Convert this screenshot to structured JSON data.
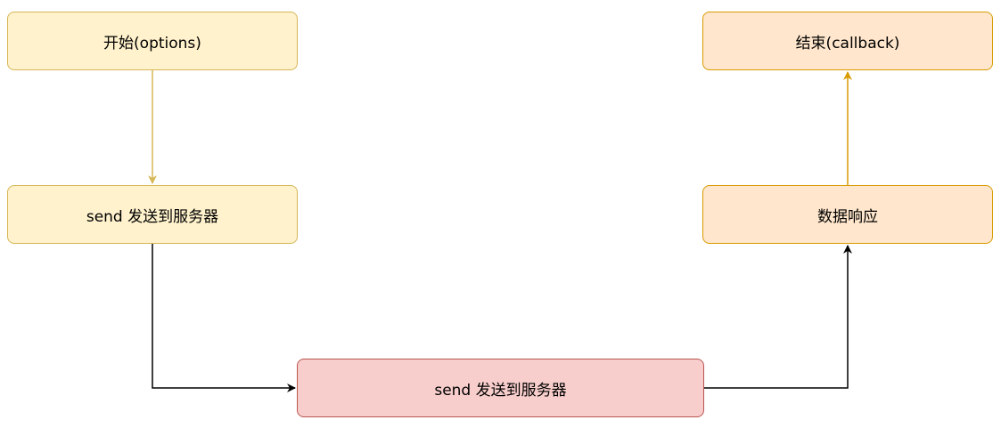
{
  "nodes": {
    "start": {
      "label": "开始(options)"
    },
    "send_client": {
      "label": "send 发送到服务器"
    },
    "send_server": {
      "label": "send 发送到服务器"
    },
    "response": {
      "label": "数据响应"
    },
    "end": {
      "label": "结束(callback)"
    }
  },
  "colors": {
    "yellow_fill": "#fff2cc",
    "yellow_stroke": "#d6b656",
    "orange_fill": "#ffe6cc",
    "orange_stroke": "#d79b00",
    "red_fill": "#f8cecc",
    "red_stroke": "#b85450",
    "edge_default": "#000000"
  },
  "edges": [
    {
      "from": "start",
      "to": "send_client",
      "color": "#d6b656"
    },
    {
      "from": "send_client",
      "to": "send_server",
      "color": "#000000"
    },
    {
      "from": "send_server",
      "to": "response",
      "color": "#000000"
    },
    {
      "from": "response",
      "to": "end",
      "color": "#d79b00"
    }
  ]
}
